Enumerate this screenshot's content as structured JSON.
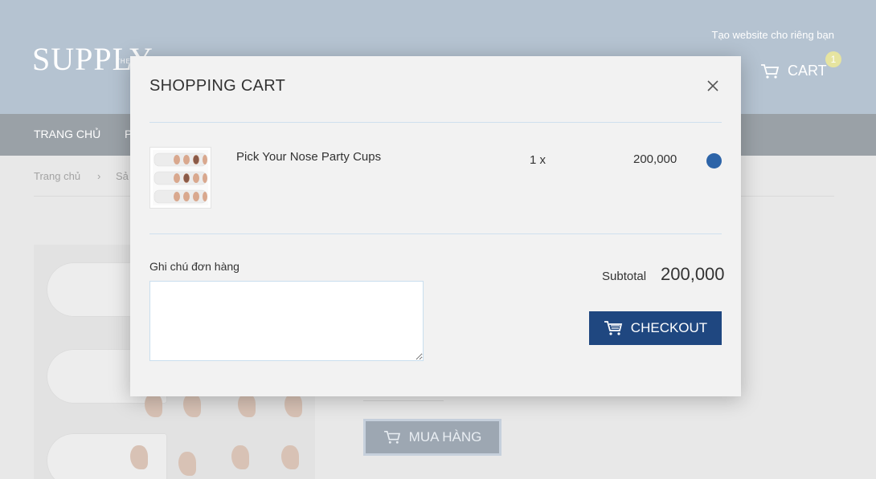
{
  "header": {
    "logo": "SUPPLY",
    "logo_sub": "THEME",
    "top_link": "Tạo website cho riêng bạn",
    "cart_label": "CART",
    "cart_count": "1"
  },
  "nav": {
    "items": [
      {
        "label": "TRANG CHỦ"
      },
      {
        "label": "P"
      }
    ]
  },
  "breadcrumb": {
    "items": [
      {
        "label": "Trang chủ"
      },
      {
        "label": "›"
      },
      {
        "label": "Sả"
      }
    ]
  },
  "product": {
    "buy_label": "MUA HÀNG"
  },
  "cart_modal": {
    "title": "SHOPPING CART",
    "items": [
      {
        "name": "Pick Your Nose Party Cups",
        "qty": "1 x",
        "price": "200,000"
      }
    ],
    "note_label": "Ghi chú đơn hàng",
    "note_value": "",
    "subtotal_label": "Subtotal",
    "subtotal_value": "200,000",
    "checkout_label": "CHECKOUT"
  },
  "colors": {
    "header_bg": "#b5c3d1",
    "nav_bg": "#9aa1a7",
    "checkout_bg": "#1f4780",
    "remove_dot": "#2d64a8",
    "badge_bg": "#e6e4a0"
  },
  "icons": [
    "cart-icon",
    "close-icon",
    "remove-item-icon"
  ]
}
